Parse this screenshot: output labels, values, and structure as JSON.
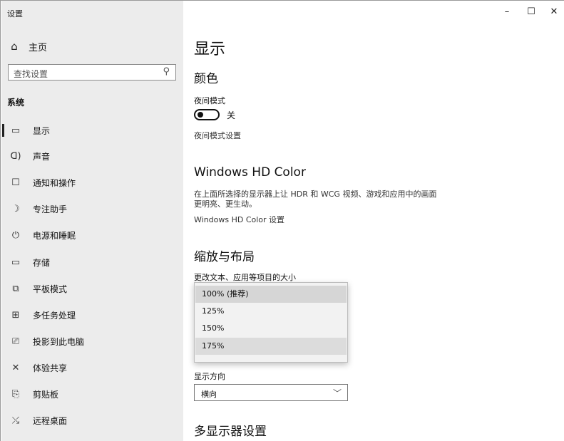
{
  "window": {
    "title": "设置",
    "controls": {
      "minimize": "–",
      "maximize": "☐",
      "close": "✕"
    }
  },
  "sidebar": {
    "home_label": "主页",
    "search_placeholder": "查找设置",
    "section_title": "系统",
    "items": [
      {
        "label": "显示",
        "icon": "monitor-icon",
        "glyph": "▭",
        "active": true
      },
      {
        "label": "声音",
        "icon": "speaker-icon",
        "glyph": "🔈",
        "active": false
      },
      {
        "label": "通知和操作",
        "icon": "notification-icon",
        "glyph": "☐",
        "active": false
      },
      {
        "label": "专注助手",
        "icon": "moon-icon",
        "glyph": "☽",
        "active": false
      },
      {
        "label": "电源和睡眠",
        "icon": "power-icon",
        "glyph": "⏻",
        "active": false
      },
      {
        "label": "存储",
        "icon": "storage-icon",
        "glyph": "▭",
        "active": false
      },
      {
        "label": "平板模式",
        "icon": "tablet-icon",
        "glyph": "⧉",
        "active": false
      },
      {
        "label": "多任务处理",
        "icon": "multitask-icon",
        "glyph": "⊞",
        "active": false
      },
      {
        "label": "投影到此电脑",
        "icon": "projector-icon",
        "glyph": "⎚",
        "active": false
      },
      {
        "label": "体验共享",
        "icon": "share-icon",
        "glyph": "✕",
        "active": false
      },
      {
        "label": "剪贴板",
        "icon": "clipboard-icon",
        "glyph": "📋",
        "active": false
      },
      {
        "label": "远程桌面",
        "icon": "remote-icon",
        "glyph": "⤯",
        "active": false
      }
    ]
  },
  "main": {
    "page_title": "显示",
    "color_section": "颜色",
    "night_light_label": "夜间模式",
    "night_light_state": "关",
    "night_light_settings_link": "夜间模式设置",
    "hdr_section": "Windows HD Color",
    "hdr_description": "在上面所选择的显示器上让 HDR 和 WCG 视频、游戏和应用中的画面更明亮、更生动。",
    "hdr_settings_link": "Windows HD Color 设置",
    "scale_section": "缩放与布局",
    "scale_label": "更改文本、应用等项目的大小",
    "scale_options": [
      "100% (推荐)",
      "125%",
      "150%",
      "175%"
    ],
    "scale_selected": "100% (推荐)",
    "orientation_label": "显示方向",
    "orientation_value": "横向",
    "multi_display_section": "多显示器设置"
  }
}
